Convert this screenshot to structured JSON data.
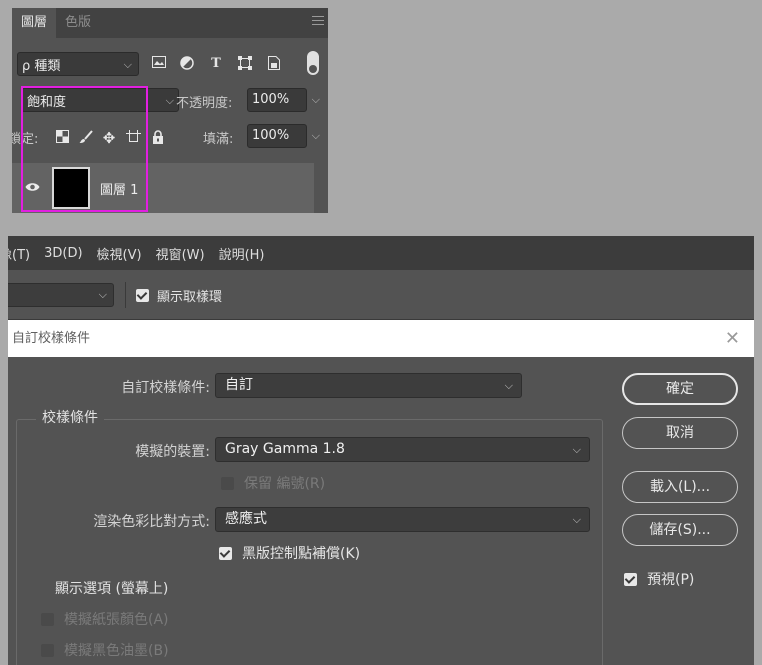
{
  "layers_panel": {
    "tabs": [
      "圖層",
      "色版"
    ],
    "filter_select": "ρ 種類",
    "filter_icons": [
      "image-filter-icon",
      "adjustment-filter-icon",
      "type-filter-icon",
      "shape-filter-icon",
      "smart-object-filter-icon"
    ],
    "blend_mode": "飽和度",
    "opacity_label": "不透明度:",
    "opacity_value": "100%",
    "lock_label": "鎖定:",
    "fill_label": "填滿:",
    "fill_value": "100%",
    "layer_name": "圖層 1",
    "highlight_color": "#e21fe1"
  },
  "app": {
    "menu": [
      "影像(T)",
      "3D(D)",
      "檢視(V)",
      "視窗(W)",
      "說明(H)"
    ],
    "show_sampling_ring_label": "顯示取樣環"
  },
  "dialog": {
    "title": "自訂校樣條件",
    "close": "✕",
    "custom_label": "自訂校樣條件:",
    "custom_value": "自訂",
    "group_title": "校樣條件",
    "device_label": "模擬的裝置:",
    "device_value": "Gray Gamma 1.8",
    "preserve_numbers": "保留 編號(R)",
    "intent_label": "渲染色彩比對方式:",
    "intent_value": "感應式",
    "bpc_label": "黑版控制點補償(K)",
    "display_options": "顯示選項 (螢幕上)",
    "simulate_paper": "模擬紙張顏色(A)",
    "simulate_black": "模擬黑色油墨(B)",
    "buttons": {
      "ok": "確定",
      "cancel": "取消",
      "load": "載入(L)...",
      "save": "儲存(S)..."
    },
    "preview_label": "預視(P)"
  }
}
